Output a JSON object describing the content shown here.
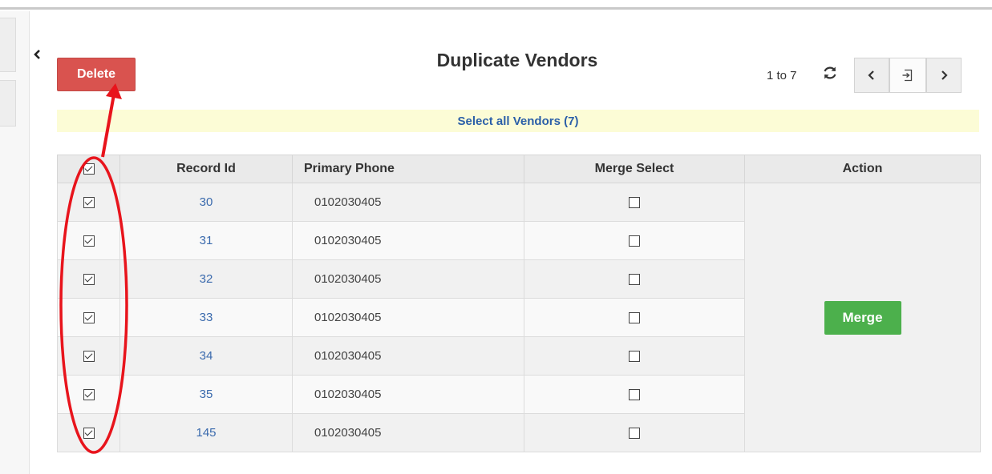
{
  "header": {
    "delete_label": "Delete",
    "title": "Duplicate Vendors",
    "pager_info": "1 to 7"
  },
  "select_all_label": "Select all Vendors (7)",
  "table": {
    "headers": [
      "Record Id",
      "Primary Phone",
      "Merge Select",
      "Action"
    ],
    "rows": [
      {
        "id": "30",
        "phone": "0102030405",
        "checked": true,
        "merge_select": false
      },
      {
        "id": "31",
        "phone": "0102030405",
        "checked": true,
        "merge_select": false
      },
      {
        "id": "32",
        "phone": "0102030405",
        "checked": true,
        "merge_select": false
      },
      {
        "id": "33",
        "phone": "0102030405",
        "checked": true,
        "merge_select": false
      },
      {
        "id": "34",
        "phone": "0102030405",
        "checked": true,
        "merge_select": false
      },
      {
        "id": "35",
        "phone": "0102030405",
        "checked": true,
        "merge_select": false
      },
      {
        "id": "145",
        "phone": "0102030405",
        "checked": true,
        "merge_select": false
      }
    ],
    "merge_label": "Merge"
  },
  "icons": {
    "collapse": "chevron-left-icon",
    "refresh": "refresh-icon",
    "prev": "chevron-left-icon",
    "export": "export-icon",
    "next": "chevron-right-icon"
  },
  "colors": {
    "delete": "#d9534f",
    "merge": "#4cb04c",
    "link": "#2b5fa8",
    "highlight_bar": "#fcfcd6",
    "annotation": "#e8141c"
  }
}
